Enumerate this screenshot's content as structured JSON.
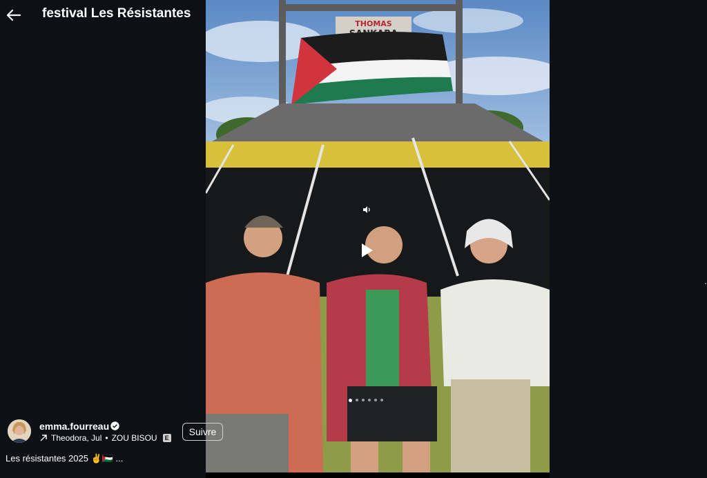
{
  "header": {
    "title": "festival Les Résistantes",
    "back_icon": "arrow-left-icon"
  },
  "post": {
    "username": "emma.fourreau",
    "verified_icon": "verified-badge-icon",
    "audio_artists": "Theodora, Jul",
    "audio_song": "ZOU BISOU",
    "audio_separator": "•",
    "explicit_badge": "E",
    "follow_label": "Suivre",
    "caption": "Les résistantes 2025 ✌️🇵🇸 ...",
    "carousel": {
      "count": 6,
      "current": 1
    }
  },
  "media": {
    "banner_text_top": "THOMAS",
    "banner_text_bottom": "SANKARA",
    "sound_icon": "speaker-icon",
    "play_icon": "play-icon"
  },
  "colors": {
    "panel_bg": "#0d1116",
    "text": "#ffffff",
    "follow_border": "#d0d0d0"
  }
}
